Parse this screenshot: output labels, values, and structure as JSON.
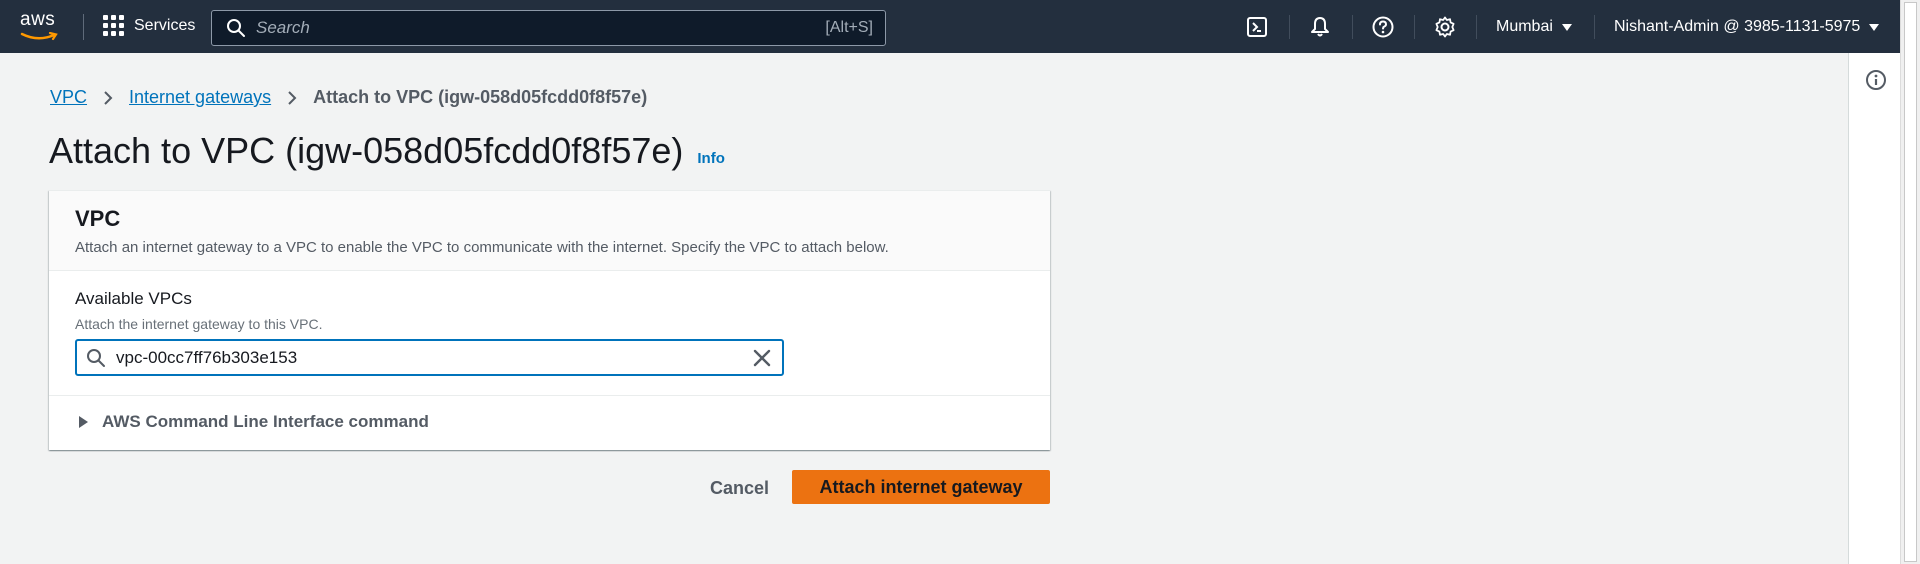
{
  "topnav": {
    "logo_text": "aws",
    "services_label": "Services",
    "search_placeholder": "Search",
    "search_shortcut": "[Alt+S]",
    "region_label": "Mumbai",
    "account_label": "Nishant-Admin @ 3985-1131-5975",
    "icons": [
      "cloudshell-icon",
      "bell-icon",
      "help-icon",
      "settings-icon"
    ]
  },
  "breadcrumb": {
    "items": [
      "VPC",
      "Internet gateways"
    ],
    "current": "Attach to VPC (igw-058d05fcdd0f8f57e)"
  },
  "page": {
    "title": "Attach to VPC (igw-058d05fcdd0f8f57e)",
    "info_label": "Info"
  },
  "vpc_section": {
    "heading": "VPC",
    "description": "Attach an internet gateway to a VPC to enable the VPC to communicate with the internet. Specify the VPC to attach below.",
    "field_label": "Available VPCs",
    "field_description": "Attach the internet gateway to this VPC.",
    "field_value": "vpc-00cc7ff76b303e153",
    "cli_label": "AWS Command Line Interface command"
  },
  "actions": {
    "cancel_label": "Cancel",
    "submit_label": "Attach internet gateway"
  },
  "colors": {
    "nav_bg": "#232f3e",
    "page_bg": "#f2f3f3",
    "link": "#0073bb",
    "primary_button": "#ec7211"
  }
}
